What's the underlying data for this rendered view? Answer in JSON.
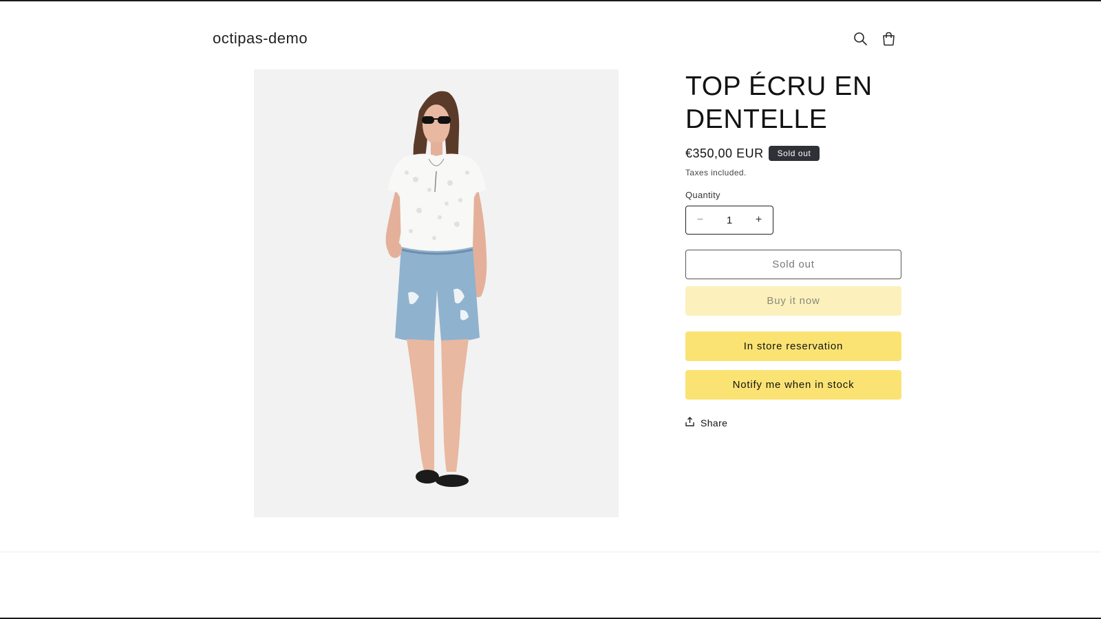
{
  "header": {
    "logo": "octipas-demo",
    "icons": [
      "search-icon",
      "cart-icon"
    ]
  },
  "product": {
    "image_alt": "Model wearing an ecru lace top with light blue distressed denim shorts and black flats",
    "title": "TOP ÉCRU EN DENTELLE",
    "price": "€350,00 EUR",
    "badge": "Sold out",
    "taxes_note": "Taxes included.",
    "quantity_label": "Quantity",
    "quantity_value": "1",
    "minus_symbol": "−",
    "plus_symbol": "+",
    "buttons": {
      "sold_out": "Sold out",
      "buy_now": "Buy it now",
      "reservation": "In store reservation",
      "notify": "Notify me when in stock"
    },
    "share_label": "Share"
  },
  "colors": {
    "accent_yellow": "#fbe373",
    "disabled_yellow": "#fcf1bc",
    "badge_bg": "#2e3138",
    "media_bg": "#f2f2f2"
  }
}
